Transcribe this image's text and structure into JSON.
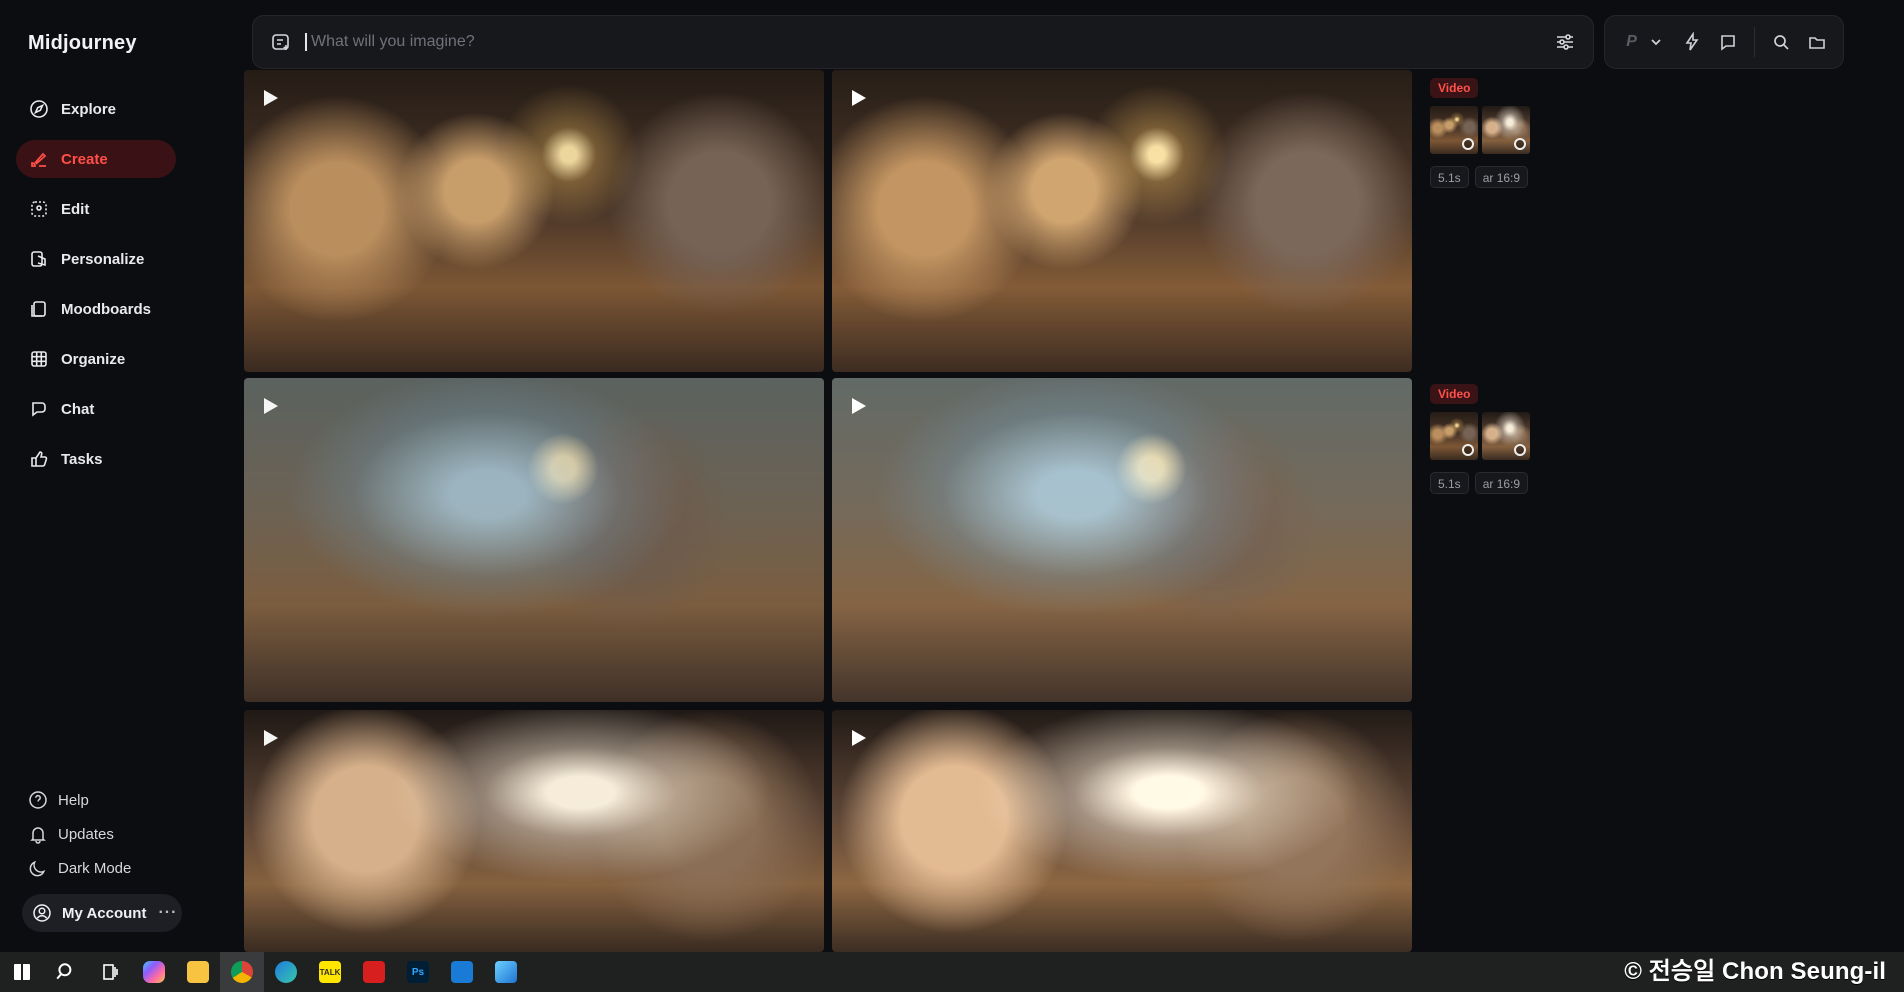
{
  "app": {
    "title": "Midjourney"
  },
  "sidebar": {
    "items": [
      {
        "label": "Explore",
        "icon": "compass-icon",
        "active": false
      },
      {
        "label": "Create",
        "icon": "brush-icon",
        "active": true
      },
      {
        "label": "Edit",
        "icon": "edit-frame-icon",
        "active": false
      },
      {
        "label": "Personalize",
        "icon": "personalize-icon",
        "active": false
      },
      {
        "label": "Moodboards",
        "icon": "moodboard-icon",
        "active": false
      },
      {
        "label": "Organize",
        "icon": "grid-icon",
        "active": false
      },
      {
        "label": "Chat",
        "icon": "chat-bubbles-icon",
        "active": false
      },
      {
        "label": "Tasks",
        "icon": "thumbs-up-icon",
        "active": false
      }
    ],
    "bottom": [
      {
        "label": "Help",
        "icon": "help-icon"
      },
      {
        "label": "Updates",
        "icon": "bell-icon"
      },
      {
        "label": "Dark Mode",
        "icon": "moon-icon"
      }
    ],
    "account": {
      "label": "My Account",
      "more": "···"
    }
  },
  "prompt": {
    "placeholder": "What will you imagine?"
  },
  "tools": {
    "personalize_letter": "P"
  },
  "gallery": {
    "groups": [
      {
        "badge": "Video",
        "chips": [
          "5.1s",
          "ar 16:9"
        ],
        "tiles": [
          "scene-a",
          "scene-a"
        ]
      },
      {
        "badge": "Video",
        "chips": [
          "5.1s",
          "ar 16:9"
        ],
        "tiles": [
          "scene-b",
          "scene-b"
        ]
      },
      {
        "badge": "",
        "chips": [],
        "tiles": [
          "scene-c",
          "scene-c"
        ]
      }
    ]
  },
  "taskbar": {
    "icons": [
      "windows-icon",
      "search-icon",
      "task-view-icon",
      "copilot-icon",
      "file-explorer-icon",
      "chrome-icon",
      "edge-icon",
      "kakaotalk-icon",
      "acrobat-icon",
      "photoshop-icon",
      "outlook-icon",
      "photos-icon"
    ],
    "labels": {
      "kakaotalk": "TALK",
      "photoshop": "Ps"
    }
  },
  "watermark": {
    "text": "© 전승일 Chon Seung-il"
  },
  "colors": {
    "accent": "#ff4f47",
    "sidebar_bg": "#0c0d11",
    "active_bg": "#3a1115"
  }
}
